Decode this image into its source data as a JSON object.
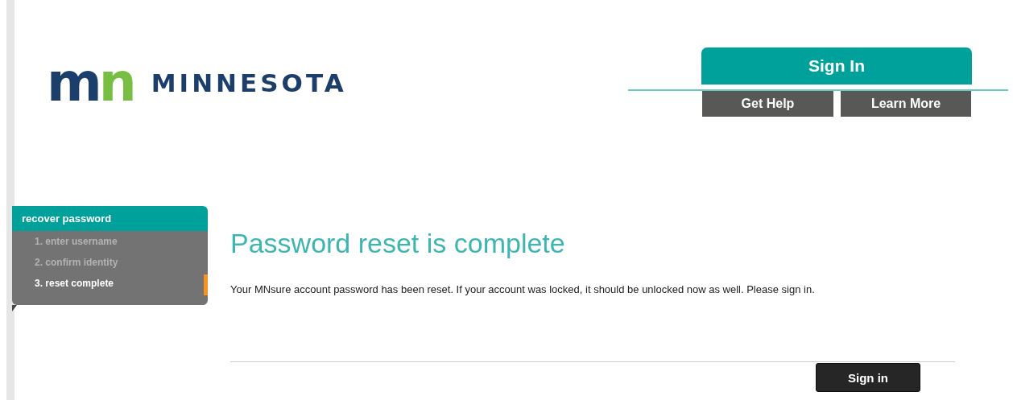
{
  "logo": {
    "mark": "mn",
    "wordmark": "MINNESOTA"
  },
  "header": {
    "sign_in_tab": "Sign In",
    "buttons": [
      "Get Help",
      "Learn More"
    ]
  },
  "sidebar": {
    "title": "recover password",
    "steps": [
      {
        "label": "1. enter username",
        "selected": false
      },
      {
        "label": "2. confirm identity",
        "selected": false
      },
      {
        "label": "3. reset complete",
        "selected": true
      }
    ]
  },
  "main": {
    "heading": "Password reset is complete",
    "message": "Your MNsure account password has been reset. If your account was locked, it should be unlocked now as well. Please sign in.",
    "button": "Sign in"
  }
}
